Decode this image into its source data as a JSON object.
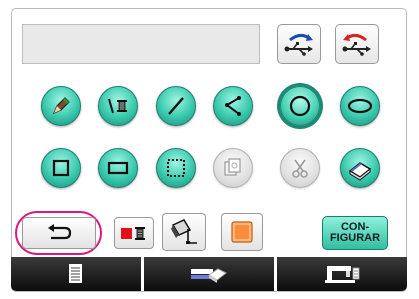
{
  "display": {
    "text": ""
  },
  "config_button": {
    "line1": "CON-",
    "line2": "FIGURAR"
  },
  "colors": {
    "teal": "#39c9ad",
    "highlight": "#e0157f",
    "tab_bar": "#111111"
  },
  "tool_icons": [
    "pencil-icon",
    "bobbin-icon",
    "straight-line-icon",
    "polyline-icon",
    "circle-icon",
    "ellipse-icon",
    "square-icon",
    "rectangle-icon",
    "dotted-rectangle-icon",
    "copy-stamp-icon",
    "scissors-icon",
    "eraser-icon"
  ],
  "bottom_tabs": [
    "document-icon",
    "eraser-tab-icon",
    "sewing-machine-icon"
  ]
}
